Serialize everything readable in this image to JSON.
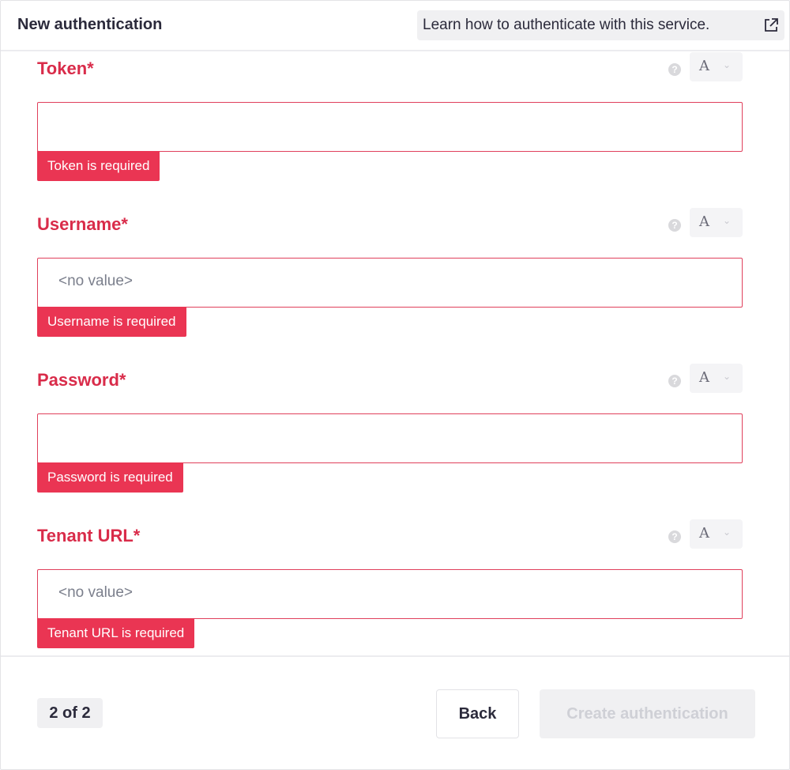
{
  "header": {
    "title": "New authentication",
    "learn_link": "Learn how to authenticate with this service."
  },
  "fields": [
    {
      "label": "Token*",
      "value": "",
      "error": "Token is required",
      "type_indicator": "A",
      "help_icon": "question-circle-icon"
    },
    {
      "label": "Username*",
      "value": "<no value>",
      "error": "Username is required",
      "type_indicator": "A",
      "help_icon": "question-circle-icon"
    },
    {
      "label": "Password*",
      "value": "",
      "error": "Password is required",
      "type_indicator": "A",
      "help_icon": "question-circle-icon"
    },
    {
      "label": "Tenant URL*",
      "value": "<no value>",
      "error": "Tenant URL is required",
      "type_indicator": "A",
      "help_icon": "question-circle-icon"
    }
  ],
  "footer": {
    "page_indicator": "2 of 2",
    "back_label": "Back",
    "create_label": "Create authentication"
  },
  "colors": {
    "error": "#ea3553",
    "label_error": "#d92c4a",
    "disabled_text": "#cfd0d6"
  }
}
